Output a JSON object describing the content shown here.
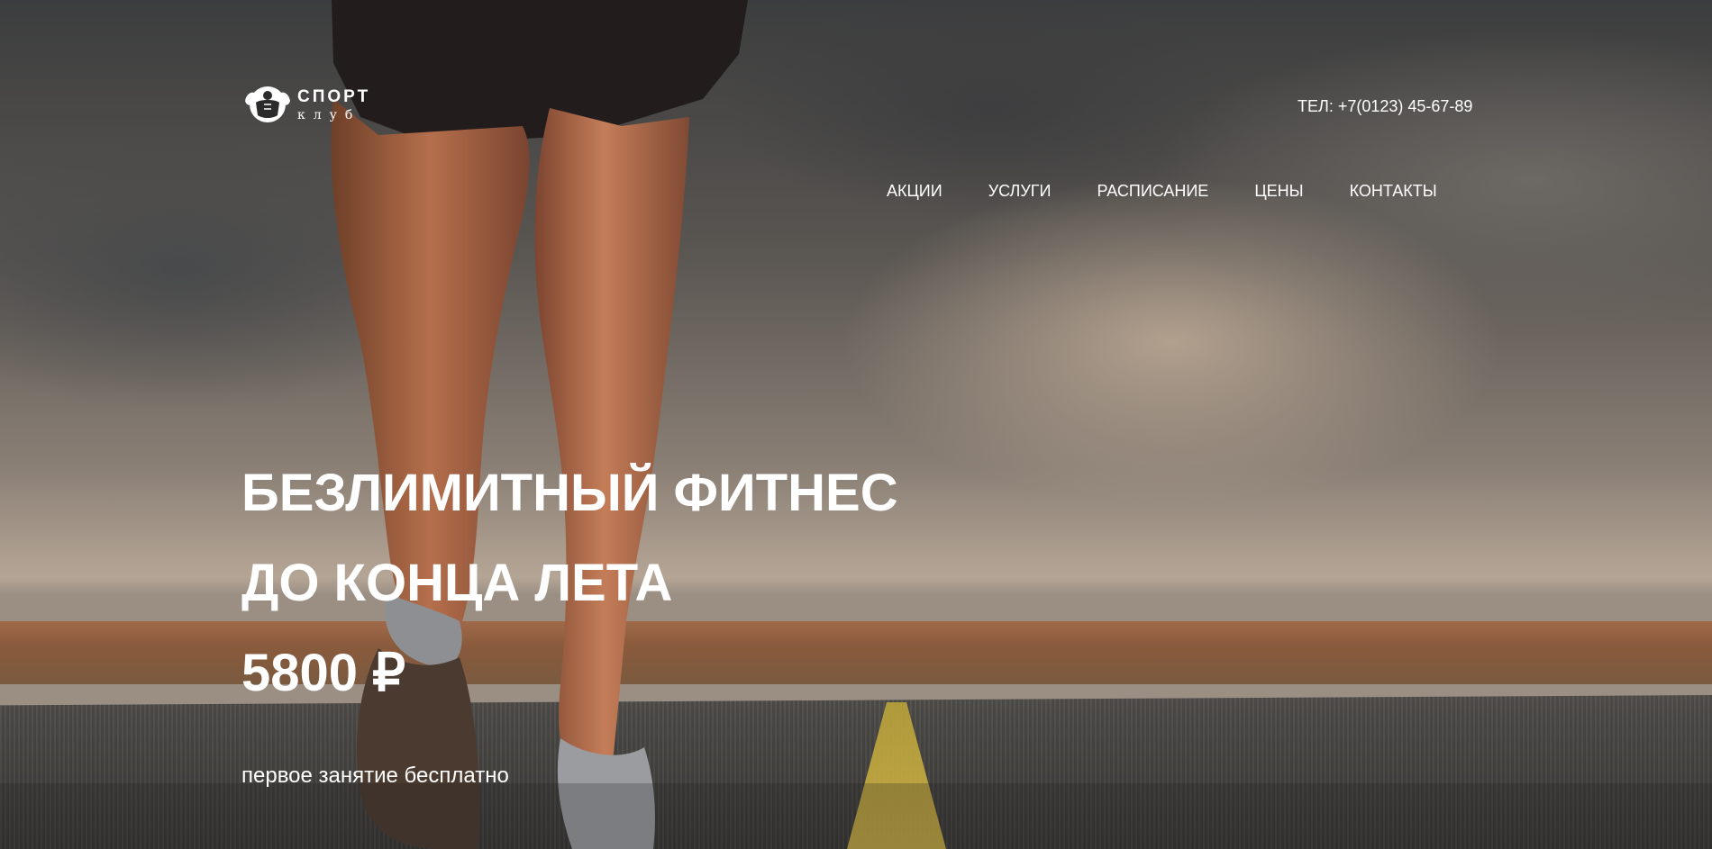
{
  "logo": {
    "icon": "bodybuilder-icon",
    "title": "СПОРТ",
    "subtitle": "клуб"
  },
  "header": {
    "phone": "ТЕЛ: +7(0123) 45-67-89"
  },
  "nav": {
    "items": [
      {
        "label": "АКЦИИ"
      },
      {
        "label": "УСЛУГИ"
      },
      {
        "label": "РАСПИСАНИЕ"
      },
      {
        "label": "ЦЕНЫ"
      },
      {
        "label": "КОНТАКТЫ"
      }
    ]
  },
  "hero": {
    "line1": "БЕЗЛИМИТНЫЙ ФИТНЕС",
    "line2": "ДО КОНЦА ЛЕТА",
    "price": "5800 ₽",
    "subtitle": "первое занятие бесплатно"
  }
}
